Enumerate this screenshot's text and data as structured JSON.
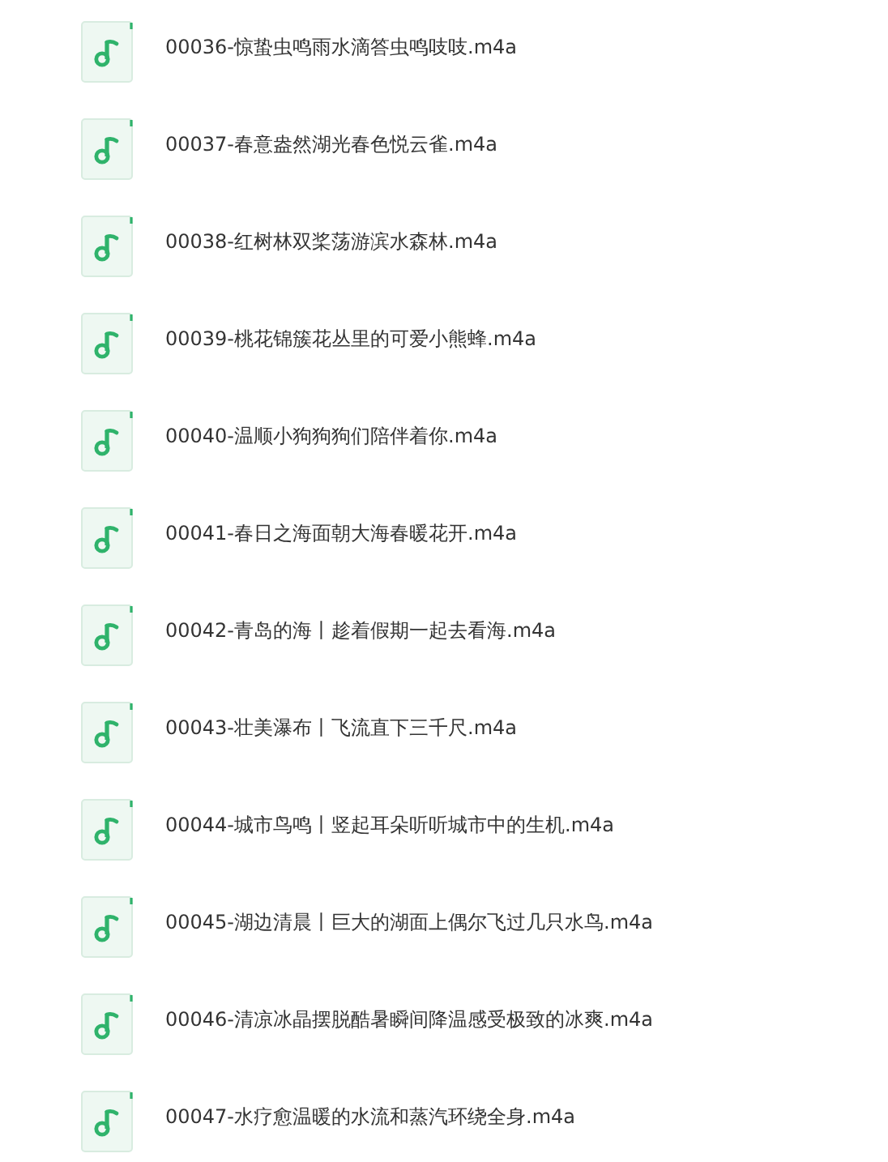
{
  "files": [
    {
      "name": "00036-惊蛰虫鸣雨水滴答虫鸣吱吱.m4a"
    },
    {
      "name": "00037-春意盎然湖光春色悦云雀.m4a"
    },
    {
      "name": "00038-红树林双桨荡游滨水森林.m4a"
    },
    {
      "name": "00039-桃花锦簇花丛里的可爱小熊蜂.m4a"
    },
    {
      "name": "00040-温顺小狗狗狗们陪伴着你.m4a"
    },
    {
      "name": "00041-春日之海面朝大海春暖花开.m4a"
    },
    {
      "name": "00042-青岛的海丨趁着假期一起去看海.m4a"
    },
    {
      "name": "00043-壮美瀑布丨飞流直下三千尺.m4a"
    },
    {
      "name": "00044-城市鸟鸣丨竖起耳朵听听城市中的生机.m4a"
    },
    {
      "name": "00045-湖边清晨丨巨大的湖面上偶尔飞过几只水鸟.m4a"
    },
    {
      "name": "00046-清凉冰晶摆脱酷暑瞬间降温感受极致的冰爽.m4a"
    },
    {
      "name": "00047-水疗愈温暖的水流和蒸汽环绕全身.m4a"
    }
  ]
}
